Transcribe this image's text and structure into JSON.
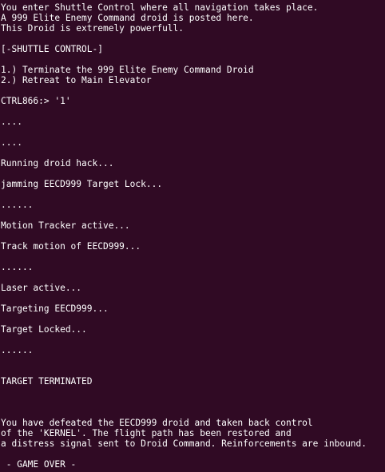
{
  "terminal": {
    "lines": [
      "You enter Shuttle Control where all navigation takes place.",
      "A 999 Elite Enemy Command droid is posted here.",
      "This Droid is extremely powerfull.",
      "",
      "[-SHUTTLE CONTROL-]",
      "",
      "1.) Terminate the 999 Elite Enemy Command Droid",
      "2.) Retreat to Main Elevator",
      "",
      "CTRL866:> '1'",
      "",
      "....",
      "",
      "....",
      "",
      "Running droid hack...",
      "",
      "jamming EECD999 Target Lock...",
      "",
      "......",
      "",
      "Motion Tracker active...",
      "",
      "Track motion of EECD999...",
      "",
      "......",
      "",
      "Laser active...",
      "",
      "Targeting EECD999...",
      "",
      "Target Locked...",
      "",
      "......",
      "",
      "",
      "TARGET TERMINATED",
      "",
      "",
      "",
      "You have defeated the EECD999 droid and taken back control",
      "of the 'KERNEL'. The flight path has been restored and",
      "a distress signal sent to Droid Command. Reinforcements are inbound.",
      "",
      " - GAME OVER -"
    ]
  }
}
